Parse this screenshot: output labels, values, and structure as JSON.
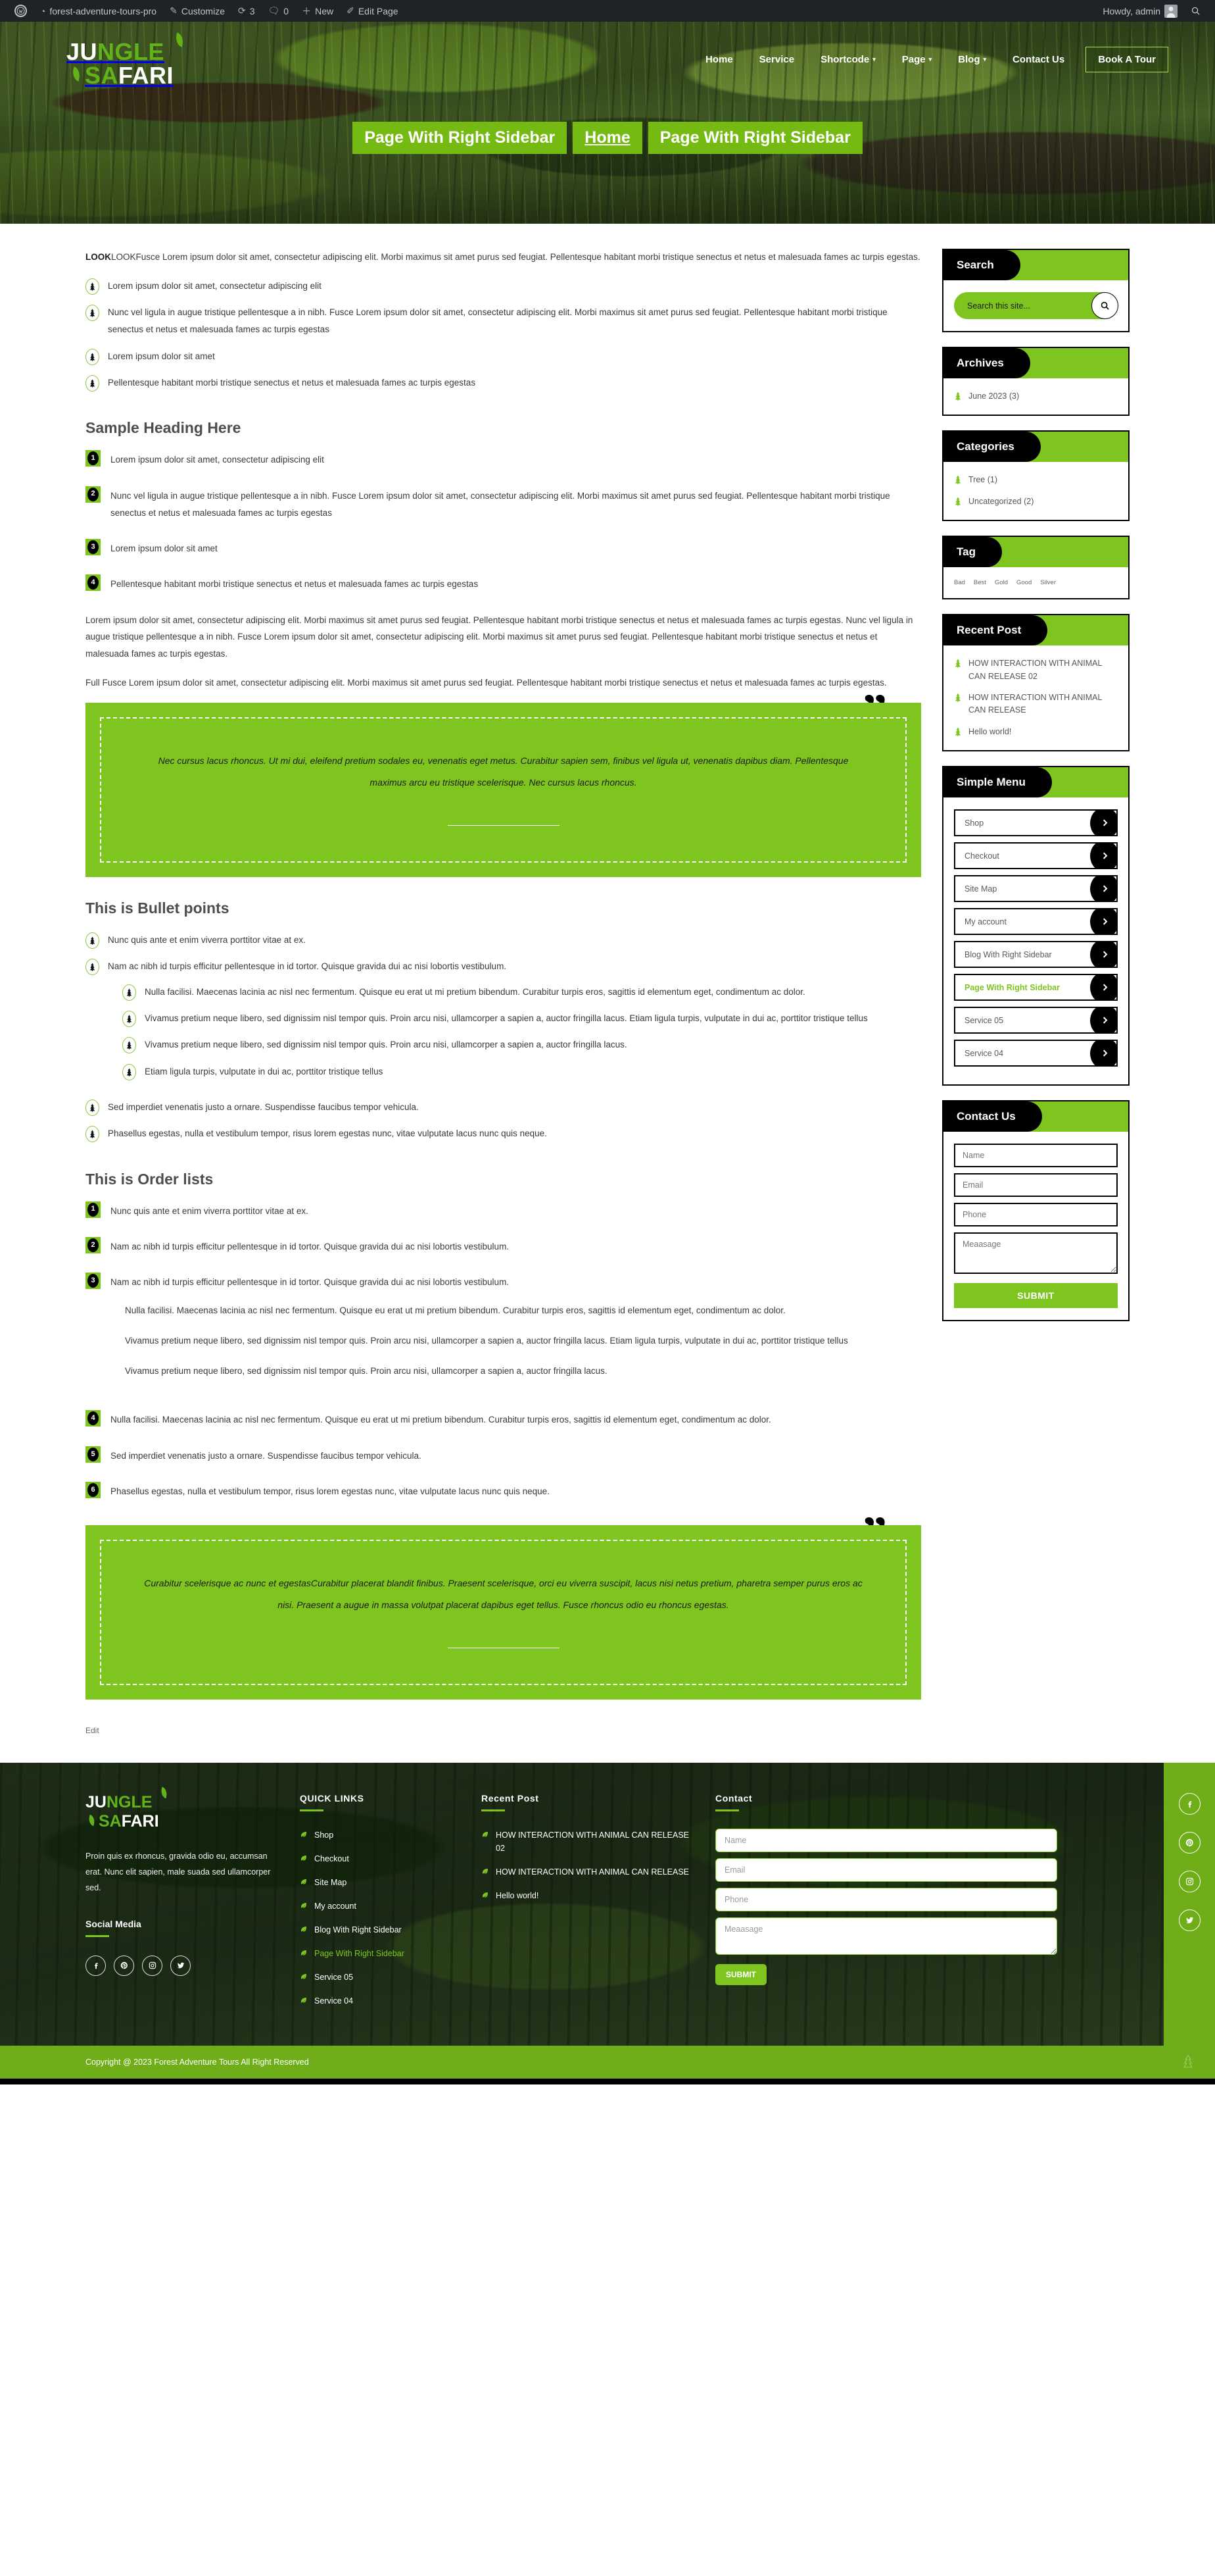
{
  "admin_bar": {
    "logo_icon": "wordpress-icon",
    "items": [
      {
        "icon": "dashboard-icon",
        "label": "forest-adventure-tours-pro"
      },
      {
        "icon": "brush-icon",
        "label": "Customize"
      },
      {
        "icon": "update-icon",
        "label": "3"
      },
      {
        "icon": "comment-icon",
        "label": "0"
      },
      {
        "icon": "plus-icon",
        "label": "New"
      },
      {
        "icon": "pencil-icon",
        "label": "Edit Page"
      }
    ],
    "howdy": "Howdy, admin",
    "search_icon": "search-icon"
  },
  "header": {
    "logo": {
      "l1a": "JU",
      "l1b": "NGLE",
      "l2a": "SA",
      "l2b": "FARI"
    },
    "nav": [
      {
        "label": "Home",
        "caret": false
      },
      {
        "label": "Service",
        "caret": false
      },
      {
        "label": "Shortcode",
        "caret": true
      },
      {
        "label": "Page",
        "caret": true
      },
      {
        "label": "Blog",
        "caret": true
      },
      {
        "label": "Contact Us",
        "caret": false
      }
    ],
    "cta": "Book A Tour",
    "breadcrumbs": [
      "Page With Right Sidebar",
      "Home",
      "Page With Right Sidebar"
    ]
  },
  "content": {
    "lead_bold": "LOOK",
    "lead_text": "LOOKFusce Lorem ipsum dolor sit amet, consectetur adipiscing elit. Morbi maximus sit amet purus sed feugiat. Pellentesque habitant morbi tristique senectus et netus et malesuada fames ac turpis egestas.",
    "intro_list": [
      "Lorem ipsum dolor sit amet, consectetur adipiscing elit",
      "Nunc vel ligula in augue tristique pellentesque a in nibh. Fusce Lorem ipsum dolor sit amet, consectetur adipiscing elit. Morbi maximus sit amet purus sed feugiat. Pellentesque habitant morbi tristique senectus et netus et malesuada fames ac turpis egestas",
      "Lorem ipsum dolor sit amet",
      "Pellentesque habitant morbi tristique senectus et netus et malesuada fames ac turpis egestas"
    ],
    "heading_sample": "Sample Heading Here",
    "sample_list": [
      "Lorem ipsum dolor sit amet, consectetur adipiscing elit",
      "Nunc vel ligula in augue tristique pellentesque a in nibh. Fusce Lorem ipsum dolor sit amet, consectetur adipiscing elit. Morbi maximus sit amet purus sed feugiat. Pellentesque habitant morbi tristique senectus et netus et malesuada fames ac turpis egestas",
      "Lorem ipsum dolor sit amet",
      "Pellentesque habitant morbi tristique senectus et netus et malesuada fames ac turpis egestas"
    ],
    "para1": "Lorem ipsum dolor sit amet, consectetur adipiscing elit. Morbi maximus sit amet purus sed feugiat. Pellentesque habitant morbi tristique senectus et netus et malesuada fames ac turpis egestas. Nunc vel ligula in augue tristique pellentesque a in nibh. Fusce Lorem ipsum dolor sit amet, consectetur adipiscing elit. Morbi maximus sit amet purus sed feugiat. Pellentesque habitant morbi tristique senectus et netus et malesuada fames ac turpis egestas.",
    "para2": "Full Fusce Lorem ipsum dolor sit amet, consectetur adipiscing elit. Morbi maximus sit amet purus sed feugiat. Pellentesque habitant morbi tristique senectus et netus et malesuada fames ac turpis egestas.",
    "quote1": "Nec cursus lacus rhoncus. Ut mi dui, eleifend pretium sodales eu, venenatis eget metus. Curabitur sapien sem, finibus vel ligula ut, venenatis dapibus diam. Pellentesque maximus arcu eu tristique scelerisque. Nec cursus lacus rhoncus.",
    "heading_bullets": "This is Bullet points",
    "bullets": [
      "Nunc quis ante et enim viverra porttitor vitae at ex.",
      "Nam ac nibh id turpis efficitur pellentesque in id tortor. Quisque gravida dui ac nisi lobortis vestibulum.",
      "Sed imperdiet venenatis justo a ornare. Suspendisse faucibus tempor vehicula.",
      "Phasellus egestas, nulla et vestibulum tempor, risus lorem egestas nunc, vitae vulputate lacus nunc quis neque."
    ],
    "bullets_nested": [
      "Nulla facilisi. Maecenas lacinia ac nisl nec fermentum. Quisque eu erat ut mi pretium bibendum. Curabitur turpis eros, sagittis id elementum eget, condimentum ac dolor.",
      "Vivamus pretium neque libero, sed dignissim nisl tempor quis. Proin arcu nisi, ullamcorper a sapien a, auctor fringilla lacus. Etiam ligula turpis, vulputate in dui ac, porttitor tristique tellus",
      "Vivamus pretium neque libero, sed dignissim nisl tempor quis. Proin arcu nisi, ullamcorper a sapien a, auctor fringilla lacus.",
      "Etiam ligula turpis, vulputate in dui ac, porttitor tristique tellus"
    ],
    "heading_orders": "This is Order lists",
    "orders": [
      "Nunc quis ante et enim viverra porttitor vitae at ex.",
      "Nam ac nibh id turpis efficitur pellentesque in id tortor. Quisque gravida dui ac nisi lobortis vestibulum.",
      "Nam ac nibh id turpis efficitur pellentesque in id tortor. Quisque gravida dui ac nisi lobortis vestibulum.",
      "Nulla facilisi. Maecenas lacinia ac nisl nec fermentum. Quisque eu erat ut mi pretium bibendum. Curabitur turpis eros, sagittis id elementum eget, condimentum ac dolor.",
      "Sed imperdiet venenatis justo a ornare. Suspendisse faucibus tempor vehicula.",
      "Phasellus egestas, nulla et vestibulum tempor, risus lorem egestas nunc, vitae vulputate lacus nunc quis neque."
    ],
    "orders_nested": [
      "Nulla facilisi. Maecenas lacinia ac nisl nec fermentum. Quisque eu erat ut mi pretium bibendum. Curabitur turpis eros, sagittis id elementum eget, condimentum ac dolor.",
      "Vivamus pretium neque libero, sed dignissim nisl tempor quis. Proin arcu nisi, ullamcorper a sapien a, auctor fringilla lacus. Etiam ligula turpis, vulputate in dui ac, porttitor tristique tellus",
      "Vivamus pretium neque libero, sed dignissim nisl tempor quis. Proin arcu nisi, ullamcorper a sapien a, auctor fringilla lacus."
    ],
    "quote2": "Curabitur scelerisque ac nunc et egestasCurabitur placerat blandit finibus. Praesent scelerisque, orci eu viverra suscipit, lacus nisi netus pretium, pharetra semper purus eros ac nisi. Praesent a augue in massa volutpat placerat dapibus eget tellus. Fusce rhoncus odio eu rhoncus egestas.",
    "edit": "Edit"
  },
  "sidebar": {
    "search": {
      "title": "Search",
      "placeholder": "Search this site...",
      "value": "",
      "icon": "search-icon"
    },
    "archives": {
      "title": "Archives",
      "items": [
        "June 2023 (3)"
      ]
    },
    "categories": {
      "title": "Categories",
      "items": [
        "Tree (1)",
        "Uncategorized (2)"
      ]
    },
    "tag": {
      "title": "Tag",
      "items": [
        "Bad",
        "Best",
        "Gold",
        "Good",
        "Silver"
      ]
    },
    "recent": {
      "title": "Recent Post",
      "items": [
        "HOW INTERACTION WITH ANIMAL CAN RELEASE 02",
        "HOW INTERACTION WITH ANIMAL CAN RELEASE",
        "Hello world!"
      ]
    },
    "menu": {
      "title": "Simple Menu",
      "items": [
        {
          "label": "Shop",
          "active": false
        },
        {
          "label": "Checkout",
          "active": false
        },
        {
          "label": "Site Map",
          "active": false
        },
        {
          "label": "My account",
          "active": false
        },
        {
          "label": "Blog With Right Sidebar",
          "active": false
        },
        {
          "label": "Page With Right Sidebar",
          "active": true
        },
        {
          "label": "Service 05",
          "active": false
        },
        {
          "label": "Service 04",
          "active": false
        }
      ]
    },
    "contact": {
      "title": "Contact Us",
      "name": "Name",
      "email": "Email",
      "phone": "Phone",
      "message": "Meaasage",
      "submit": "SUBMIT"
    }
  },
  "footer": {
    "logo": {
      "l1a": "JU",
      "l1b": "NGLE",
      "l2a": "SA",
      "l2b": "FARI"
    },
    "desc": "Proin quis ex rhoncus, gravida odio eu, accumsan erat. Nunc elit sapien, male suada sed ullamcorper sed.",
    "social_heading": "Social Media",
    "social": [
      "facebook-icon",
      "pinterest-icon",
      "instagram-icon",
      "twitter-icon"
    ],
    "quick_links_title": "QUICK LINKS",
    "quick_links": [
      {
        "label": "Shop",
        "active": false
      },
      {
        "label": "Checkout",
        "active": false
      },
      {
        "label": "Site Map",
        "active": false
      },
      {
        "label": "My account",
        "active": false
      },
      {
        "label": "Blog With Right Sidebar",
        "active": false
      },
      {
        "label": "Page With Right Sidebar",
        "active": true
      },
      {
        "label": "Service 05",
        "active": false
      },
      {
        "label": "Service 04",
        "active": false
      }
    ],
    "recent_title": "Recent Post",
    "recent": [
      "HOW INTERACTION WITH ANIMAL CAN RELEASE 02",
      "HOW INTERACTION WITH ANIMAL CAN RELEASE",
      "Hello world!"
    ],
    "contact_title": "Contact",
    "form": {
      "name": "Name",
      "email": "Email",
      "phone": "Phone",
      "message": "Meaasage",
      "submit": "SUBMIT"
    },
    "rail_social": [
      "facebook-icon",
      "pinterest-icon",
      "instagram-icon",
      "twitter-icon"
    ],
    "copyright": "Copyright @ 2023 Forest Adventure Tours All Right Reserved"
  },
  "colors": {
    "green": "#7ec520",
    "green_dark": "#6fae18",
    "black": "#000000",
    "admin_bg": "#1d2327"
  }
}
